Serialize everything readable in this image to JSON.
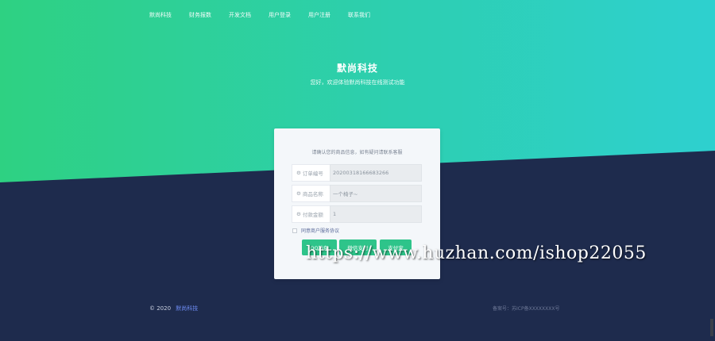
{
  "nav": {
    "items": [
      "默尚科技",
      "财务报数",
      "开发文档",
      "用户登录",
      "用户注册",
      "联系我们"
    ]
  },
  "hero": {
    "title": "默尚科技",
    "subtitle": "您好，欢迎体验默尚科技在线测试功能"
  },
  "card": {
    "notice": "请确认您的商品信息，如有疑问请联系客服",
    "fields": [
      {
        "icon": "order-icon",
        "label": "订单编号",
        "value": "20200318166683266"
      },
      {
        "icon": "goods-icon",
        "label": "商品名称",
        "value": "一个椅子~"
      },
      {
        "icon": "amount-icon",
        "label": "付款金额",
        "value": "1"
      }
    ],
    "agree_text": "同意商户服务协议",
    "buttons": {
      "qq": "QQ钱包",
      "wechat": "微信支付",
      "alipay": "支付宝"
    }
  },
  "footer": {
    "copyright": "© 2020",
    "brand": "默尚科技",
    "icp": "备案号：苏ICP备XXXXXXXX号"
  },
  "watermark": "https://www.huzhan.com/ishop22055",
  "colors": {
    "hero_start": "#2ed182",
    "hero_end": "#2ed0cf",
    "background": "#1e2b4d",
    "button": "#2ec48a",
    "brand_link": "#6f8df5"
  }
}
